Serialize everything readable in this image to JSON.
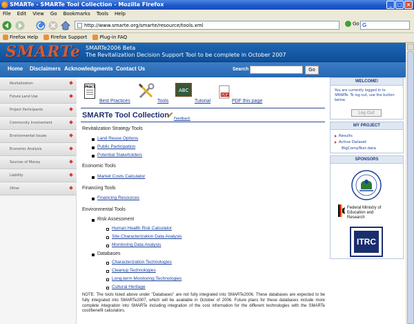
{
  "browser": {
    "title": "SMARTe - SMARTe Tool Collection - Mozilla Firefox",
    "menu": [
      "File",
      "Edit",
      "View",
      "Go",
      "Bookmarks",
      "Tools",
      "Help"
    ],
    "url": "http://www.smarte.org/smarte/resource/tools.xml",
    "go_label": "Go",
    "search_logo": "G",
    "bookmarks": [
      "Firefox Help",
      "Firefox Support",
      "Plug-in FAQ"
    ]
  },
  "site": {
    "logo": "SMARTe",
    "tagline1": "SMARTe2006 Beta",
    "tagline2": "The Revitalization Decision Support Tool to be complete in October 2007",
    "nav": [
      "Home",
      "Disclaimers",
      "Acknowledgments",
      "Contact Us"
    ],
    "search_label": "Search",
    "search_button": "Go"
  },
  "sidebar": {
    "items": [
      "Revitalization",
      "Future Land Use",
      "Project Participants",
      "Community Involvement",
      "Environmental Issues",
      "Economic Analysis",
      "Sources of Money",
      "Liability",
      "Other"
    ]
  },
  "tools_bar": {
    "best_practices": "Best Practices",
    "tools": "Tools",
    "tutorial": "Tutorial",
    "pdf": "PDF this page",
    "pract_icon": "PRACT."
  },
  "main": {
    "title": "SMARTe Tool Collection",
    "feedback": "Feedback",
    "sections": {
      "revit": "Revitalization Strategy Tools",
      "revit_links": [
        "Land Reuse Options",
        "Public Participation",
        "Potential Stakeholders"
      ],
      "econ": "Economic Tools",
      "econ_links": [
        "Market Costs Calculator"
      ],
      "fin": "Financing Tools",
      "fin_links": [
        "Financing Resources"
      ],
      "env": "Environmental Tools",
      "risk": "Risk Assessment",
      "risk_links": [
        "Human Health Risk Calculator",
        "Site Characterization Data Analysis",
        "Monitoring Data Analysis"
      ],
      "db": "Databases",
      "db_links": [
        "Characterization Technologies",
        "Cleanup Technologies",
        "Long-term Monitoring Technologies",
        "Cultural Heritage"
      ]
    },
    "note": "NOTE: The tools listed above under \"Databases\" are not fully integrated into SMARTe2006. These databases are expected to be fully integrated into SMARTe2007, which will be available in October of 2006. Future plans for these databases include more complete integration into SMARTe including integration of the cost information for the different technologies with the SMARTe cost/benefit calculators."
  },
  "right": {
    "welcome_title": "WELCOME!",
    "welcome_text": "You are currently logged in to SMARTe. To log out, use the button below.",
    "logout": "Log Out",
    "project_title": "MY PROJECT",
    "project_items": [
      "Results",
      "Active Dataset",
      "BigCompTest.data"
    ],
    "sponsors_title": "SPONSORS",
    "sponsor_bmbf": "Federal Ministry of Education and Research",
    "sponsor_itrc": "ITRC"
  },
  "colors": {
    "header": "#1e67b3",
    "nav": "#2e6fb8",
    "logo": "#d85a30",
    "link": "#1a3f9b"
  }
}
